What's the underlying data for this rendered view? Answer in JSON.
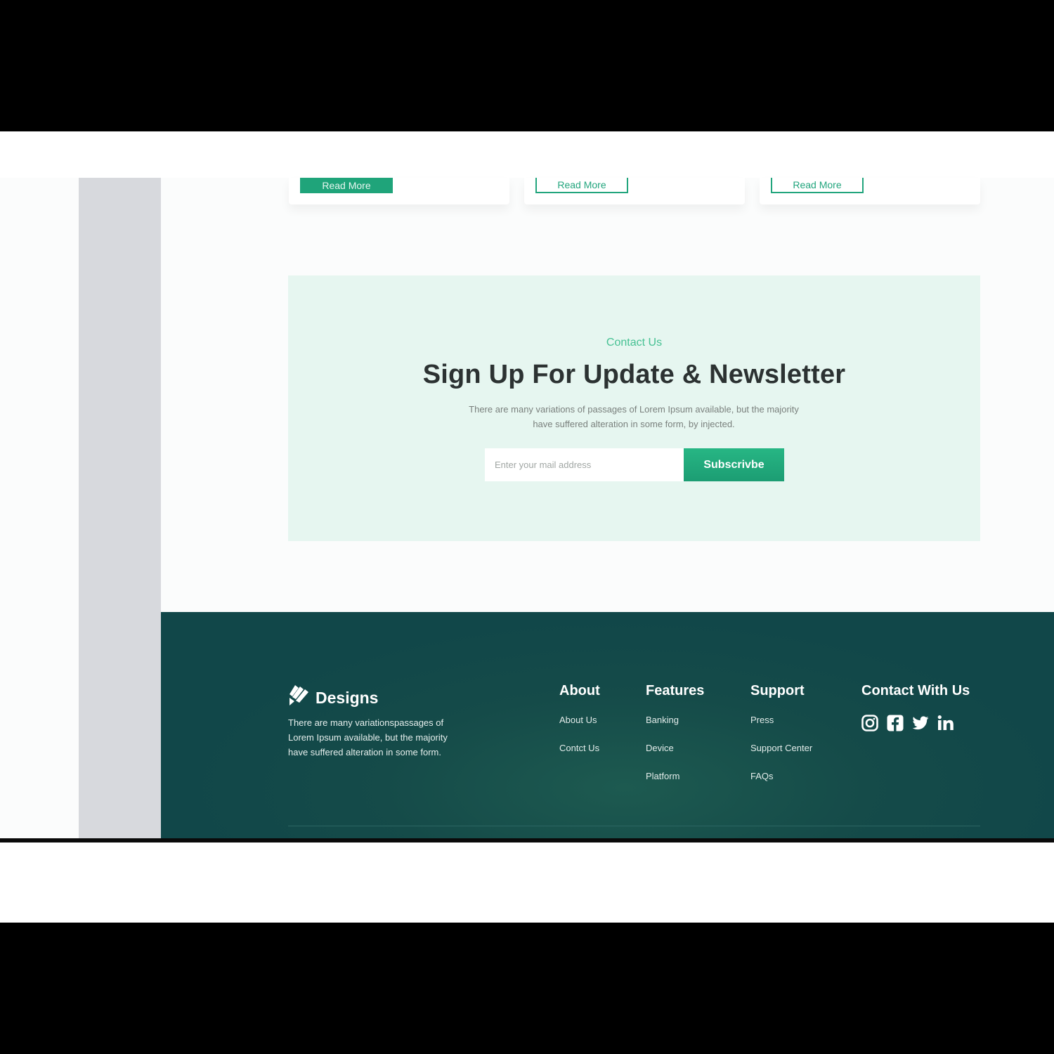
{
  "cards": [
    {
      "button_label": "Read More",
      "style": "solid"
    },
    {
      "button_label": "Read More",
      "style": "outline"
    },
    {
      "button_label": "Read More",
      "style": "outline"
    }
  ],
  "newsletter": {
    "eyebrow": "Contact Us",
    "title": "Sign Up For Update & Newsletter",
    "description": "There are many variations of passages of Lorem Ipsum available, but the majority have suffered alteration in some form, by injected.",
    "input_placeholder": "Enter your mail address",
    "button_label": "Subscrivbe"
  },
  "footer": {
    "brand": "Designs",
    "description": "There are many variationspassages of Lorem Ipsum available, but the majority have suffered alteration in some form.",
    "columns": {
      "about": {
        "title": "About",
        "links": [
          "About Us",
          "Contct Us"
        ]
      },
      "features": {
        "title": "Features",
        "links": [
          "Banking",
          "Device",
          "Platform"
        ]
      },
      "support": {
        "title": "Support",
        "links": [
          "Press",
          "Support Center",
          "FAQs"
        ]
      },
      "contact": {
        "title": "Contact With Us",
        "socials": [
          "instagram-icon",
          "facebook-icon",
          "twitter-icon",
          "linkedin-icon"
        ]
      }
    }
  },
  "colors": {
    "accent": "#1fa47a",
    "newsletter_bg": "#e6f6f0",
    "footer_bg": "#114749"
  }
}
